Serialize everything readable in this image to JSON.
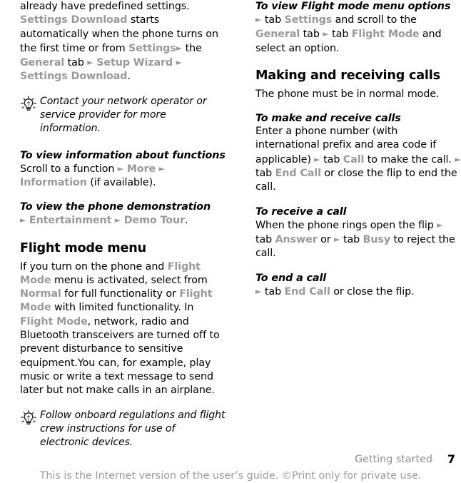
{
  "document": {
    "footer": {
      "chapter": "Getting started",
      "page_number": "7",
      "legal_notice": "This is the Internet version of the user’s guide. ©Print only for private use."
    },
    "icons": {
      "tip": "lightbulb-tip-icon"
    },
    "arrow_glyph": "►",
    "colors": {
      "keyword_gray": "#9a9a9a",
      "body_black": "#000000",
      "footer_gray": "#8e8e8e",
      "legal_gray": "#9d9d9d",
      "page_background": "#ffffff"
    }
  },
  "left_column": {
    "intro_paragraph": {
      "seg1": "already have predefined settings. ",
      "kw1": "Settings Download",
      "seg2": " starts automatically when the phone turns on the first time or from ",
      "kw2": "Settings",
      "seg3": " the ",
      "kw3": "General",
      "seg4": " tab ",
      "kw4": "Setup Wizard",
      "seg5": " ",
      "kw5": "Settings Download",
      "seg6": "."
    },
    "tip_1": "Contact your network operator or service provider for more information.",
    "section_view_info": {
      "heading": "To view information about functions",
      "seg1": "Scroll to a function ",
      "kw1": "More",
      "seg2": " ",
      "kw2": "Information",
      "seg3": " (if available)."
    },
    "section_demo": {
      "heading": "To view the phone demonstration",
      "seg1": "",
      "kw1": "Entertainment",
      "seg2": " ",
      "kw2": "Demo Tour",
      "seg3": "."
    },
    "section_flight_mode": {
      "heading": "Flight mode menu",
      "seg1": "If you turn on the phone and ",
      "kw1": "Flight Mode",
      "seg2": " menu is activated, select from ",
      "kw2": "Normal",
      "seg3": " for full functionality or ",
      "kw3": "Flight Mode",
      "seg4": " with limited functionality. In ",
      "kw4": "Flight Mode",
      "seg5": ", network, radio and Bluetooth transceivers are turned off to prevent disturbance to sensitive equipment.You can, for example, play music or write a text message to send later but not make calls in an airplane."
    },
    "tip_2": "Follow onboard regulations and flight crew instructions for use of electronic devices."
  },
  "right_column": {
    "section_view_options": {
      "heading": "To view Flight mode menu options",
      "seg1": "",
      "kw1": "Settings",
      "seg2": " and scroll to the ",
      "kw2": "General",
      "seg3": " tab ",
      "kw3": "Flight Mode",
      "seg4": " and select an option."
    },
    "section_calls": {
      "heading": "Making and receiving calls",
      "intro": "The phone must be in normal mode."
    },
    "section_make_receive": {
      "heading": "To make and receive calls",
      "seg1": "Enter a phone number (with international prefix and area code if applicable) ",
      "kw1": "Call",
      "seg2": " to make the call. ",
      "kw2": "End Call",
      "seg3": " or close the flip to end the call."
    },
    "section_receive": {
      "heading": "To receive a call",
      "seg1": "When the phone rings open the flip ",
      "kw1": "Answer",
      "seg2": " or ",
      "kw2": "Busy",
      "seg3": " to reject the call."
    },
    "section_end": {
      "heading": "To end a call",
      "seg1": "",
      "kw1": "End Call",
      "seg2": " or close the flip."
    }
  }
}
